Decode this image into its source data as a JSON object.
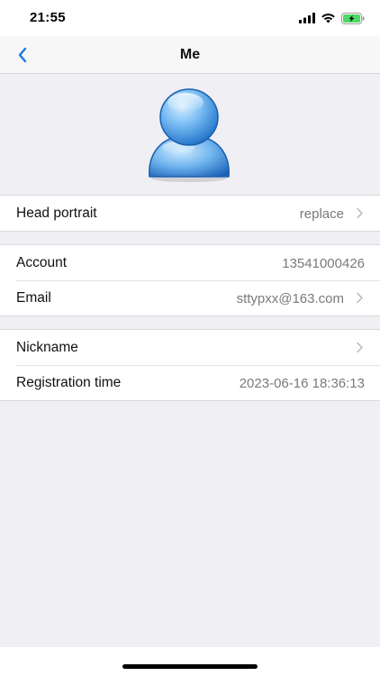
{
  "status_bar": {
    "time": "21:55"
  },
  "nav": {
    "title": "Me",
    "accent": "#1a7be0"
  },
  "profile": {
    "head_portrait_label": "Head portrait",
    "head_portrait_value": "replace",
    "account_label": "Account",
    "account_value": "13541000426",
    "email_label": "Email",
    "email_value": "sttypxx@163.com",
    "nickname_label": "Nickname",
    "nickname_value": "",
    "registration_label": "Registration time",
    "registration_value": "2023-06-16 18:36:13"
  },
  "icons": {
    "back": "chevron-left-icon",
    "chevron": "chevron-right-icon",
    "avatar": "user-avatar-icon",
    "signal": "cellular-signal-icon",
    "wifi": "wifi-icon",
    "battery": "battery-charging-icon"
  },
  "colors": {
    "background": "#efeff4",
    "battery": "#4cd964"
  }
}
